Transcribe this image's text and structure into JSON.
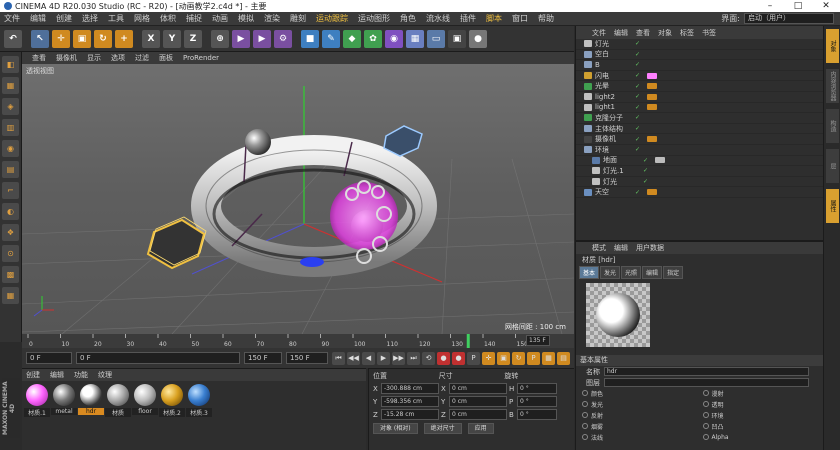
{
  "window": {
    "title": "CINEMA 4D R20.030 Studio (RC - R20) - [动画教学2.c4d *] - 主要",
    "buttons": [
      "–",
      "□",
      "✕"
    ]
  },
  "menubar": {
    "items": [
      {
        "label": "文件",
        "hl": false
      },
      {
        "label": "编辑",
        "hl": false
      },
      {
        "label": "创建",
        "hl": false
      },
      {
        "label": "选择",
        "hl": false
      },
      {
        "label": "工具",
        "hl": false
      },
      {
        "label": "网格",
        "hl": false
      },
      {
        "label": "体积",
        "hl": false
      },
      {
        "label": "捕捉",
        "hl": false
      },
      {
        "label": "动画",
        "hl": false
      },
      {
        "label": "模拟",
        "hl": false
      },
      {
        "label": "渲染",
        "hl": false
      },
      {
        "label": "雕刻",
        "hl": false
      },
      {
        "label": "运动跟踪",
        "hl": true
      },
      {
        "label": "运动图形",
        "hl": false
      },
      {
        "label": "角色",
        "hl": false
      },
      {
        "label": "流水线",
        "hl": false
      },
      {
        "label": "插件",
        "hl": false
      },
      {
        "label": "脚本",
        "hl": true
      },
      {
        "label": "窗口",
        "hl": false
      },
      {
        "label": "帮助",
        "hl": false
      }
    ],
    "interface_label": "界面:",
    "interface_value": "启动（用户）"
  },
  "toolbar": {
    "buttons": [
      {
        "name": "undo",
        "glyph": "↶",
        "color": "#555555"
      },
      {
        "name": "live-select",
        "glyph": "↖",
        "color": "#4f6f9a"
      },
      {
        "name": "move",
        "glyph": "✛",
        "color": "#d08a20"
      },
      {
        "name": "scale",
        "glyph": "▣",
        "color": "#d08a20"
      },
      {
        "name": "rotate",
        "glyph": "↻",
        "color": "#d08a20"
      },
      {
        "name": "last-tool",
        "glyph": "+",
        "color": "#d08a20"
      },
      {
        "name": "x-axis",
        "glyph": "X",
        "color": "#555555"
      },
      {
        "name": "y-axis",
        "glyph": "Y",
        "color": "#555555"
      },
      {
        "name": "z-axis",
        "glyph": "Z",
        "color": "#555555"
      },
      {
        "name": "coord-system",
        "glyph": "⊕",
        "color": "#555555"
      },
      {
        "name": "render-view",
        "glyph": "▶",
        "color": "#7a4fa0"
      },
      {
        "name": "render-picture",
        "glyph": "▶",
        "color": "#7a4fa0"
      },
      {
        "name": "render-settings",
        "glyph": "⚙",
        "color": "#7a4fa0"
      },
      {
        "name": "cube",
        "glyph": "■",
        "color": "#3e7fc0"
      },
      {
        "name": "pen",
        "glyph": "✎",
        "color": "#3e7fc0"
      },
      {
        "name": "subdivision",
        "glyph": "◆",
        "color": "#40a050"
      },
      {
        "name": "cloner",
        "glyph": "✿",
        "color": "#40a050"
      },
      {
        "name": "deformer",
        "glyph": "◉",
        "color": "#8050c0"
      },
      {
        "name": "field",
        "glyph": "▦",
        "color": "#6a7fc0"
      },
      {
        "name": "floor",
        "glyph": "▭",
        "color": "#5a7aa8"
      },
      {
        "name": "camera",
        "glyph": "▣",
        "color": "#444444"
      },
      {
        "name": "light",
        "glyph": "●",
        "color": "#777777"
      }
    ]
  },
  "leftbar": {
    "tools": [
      "◧",
      "▦",
      "◈",
      "▥",
      "◉",
      "▤",
      "⌐",
      "◐",
      "❖",
      "⊙",
      "▩",
      "▦"
    ],
    "logo": "MAXON CINEMA 4D"
  },
  "viewport": {
    "menu": [
      "查看",
      "摄像机",
      "显示",
      "选项",
      "过滤",
      "面板",
      "ProRender"
    ],
    "label": "透视视图",
    "grid_info": "网格间距 : 100 cm"
  },
  "timeline": {
    "ticks": [
      "0",
      "10",
      "20",
      "30",
      "40",
      "50",
      "60",
      "70",
      "80",
      "90",
      "100",
      "110",
      "120",
      "130",
      "140",
      "150"
    ],
    "current_label": "135 F"
  },
  "transport": {
    "start": "0 F",
    "field2": "0 F",
    "field3": "150 F",
    "end": "150 F",
    "buttons": [
      "⏮",
      "◀◀",
      "◀",
      "▶",
      "▶▶",
      "⏭",
      "⟲",
      "●",
      "●",
      "P",
      "✛",
      "▣",
      "↻",
      "P",
      "▦",
      "▤"
    ]
  },
  "materials": {
    "menu": [
      "创建",
      "编辑",
      "功能",
      "纹理"
    ],
    "items": [
      {
        "label": "材质.1",
        "ball": "radial-gradient(circle at 35% 35%, #fff, #ff66ff 45%, #992299)",
        "selected": false
      },
      {
        "label": "metal",
        "ball": "radial-gradient(circle at 35% 35%, #fff, #777 45%, #111)",
        "selected": false
      },
      {
        "label": "hdr",
        "ball": "radial-gradient(circle at 35% 35%, #fff 25%, #333 70%)",
        "selected": true
      },
      {
        "label": "材质",
        "ball": "radial-gradient(circle at 35% 35%, #fff, #aaa 45%, #333)",
        "selected": false
      },
      {
        "label": "floor",
        "ball": "radial-gradient(circle at 35% 35%, #fff, #bbb 45%, #444)",
        "selected": false
      },
      {
        "label": "材质.2",
        "ball": "radial-gradient(circle at 35% 35%, #ffe9a0, #d9a020 45%, #5a3b00)",
        "selected": false
      },
      {
        "label": "材质.3",
        "ball": "radial-gradient(circle at 35% 35%, #bfe0ff, #3a7fd0 45%, #0a2a60)",
        "selected": false
      }
    ]
  },
  "coords": {
    "headers": [
      "位置",
      "尺寸",
      "旋转"
    ],
    "rows": [
      {
        "axis": "X",
        "pos": "-300.888 cm",
        "size_axis": "X",
        "size": "0 cm",
        "rot_axis": "H",
        "rot": "0 °"
      },
      {
        "axis": "Y",
        "pos": "-598.356 cm",
        "size_axis": "Y",
        "size": "0 cm",
        "rot_axis": "P",
        "rot": "0 °"
      },
      {
        "axis": "Z",
        "pos": "-15.28 cm",
        "size_axis": "Z",
        "size": "0 cm",
        "rot_axis": "B",
        "rot": "0 °"
      }
    ],
    "mode": "对象 (相对)",
    "size_mode": "绝对尺寸",
    "apply": "应用"
  },
  "objects": {
    "menu": [
      "文件",
      "编辑",
      "查看",
      "对象",
      "标签",
      "书签"
    ],
    "items": [
      {
        "name": "灯光",
        "icon": "#c0c0c0",
        "tag": ""
      },
      {
        "name": "空白",
        "icon": "#8aa0c0",
        "tag": ""
      },
      {
        "name": "B",
        "icon": "#8aa0c0",
        "tag": ""
      },
      {
        "name": "闪电",
        "icon": "#d0a030",
        "tag": "#ff80ff"
      },
      {
        "name": "光晕",
        "icon": "#40a050",
        "tag": "#d08a20"
      },
      {
        "name": "light2",
        "icon": "#c0c0c0",
        "tag": "#d08a20"
      },
      {
        "name": "light1",
        "icon": "#c0c0c0",
        "tag": "#d08a20"
      },
      {
        "name": "克隆分子",
        "icon": "#40a050",
        "tag": ""
      },
      {
        "name": "主体结构",
        "icon": "#8aa0c0",
        "tag": ""
      },
      {
        "name": "摄像机",
        "icon": "#444444",
        "tag": "#d08a20"
      },
      {
        "name": "环境",
        "icon": "#8aa0c0",
        "tag": ""
      },
      {
        "name": "地面",
        "icon": "#5a7aa8",
        "tag": "#bbbbbb"
      },
      {
        "name": "灯光.1",
        "icon": "#c0c0c0",
        "tag": ""
      },
      {
        "name": "灯光",
        "icon": "#c0c0c0",
        "tag": ""
      },
      {
        "name": "天空",
        "icon": "#6a8fc0",
        "tag": "#d08a20"
      }
    ]
  },
  "attributes": {
    "menu": [
      "模式",
      "编辑",
      "用户数据"
    ],
    "title": "材质 [hdr]",
    "tabs": [
      {
        "label": "基本",
        "active": true
      },
      {
        "label": "发光",
        "active": false
      },
      {
        "label": "光照",
        "active": false
      },
      {
        "label": "编辑",
        "active": false
      },
      {
        "label": "指定",
        "active": false
      }
    ],
    "section": "基本属性",
    "name_label": "名称",
    "name_value": "hdr",
    "layer_label": "图层",
    "channels": [
      "颜色",
      "漫射",
      "发光",
      "透明",
      "反射",
      "环境",
      "烟雾",
      "凹凸",
      "法线",
      "Alpha"
    ]
  },
  "rightstrip": [
    {
      "label": "对象",
      "active": true
    },
    {
      "label": "内容浏览器",
      "active": false
    },
    {
      "label": "构造",
      "active": false
    },
    {
      "label": "层",
      "active": false
    },
    {
      "label": "属性",
      "active": true
    }
  ]
}
